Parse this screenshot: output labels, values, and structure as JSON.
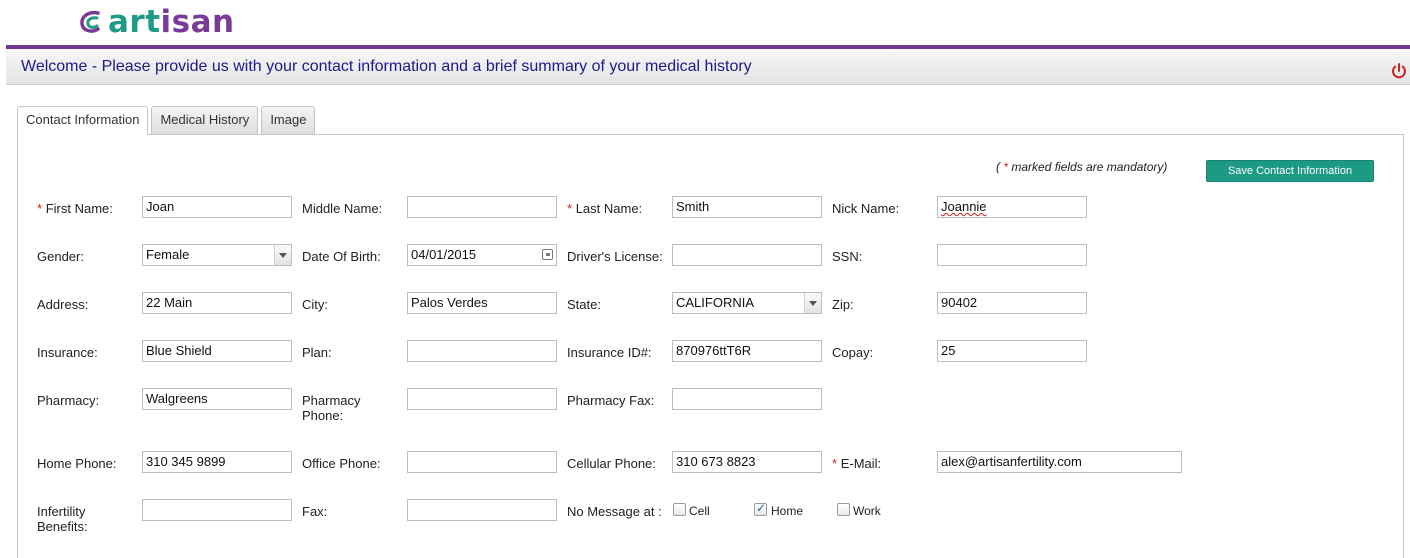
{
  "brand": {
    "name_part1": "art",
    "name_part2": "isan",
    "teal": "#1f9a84",
    "purple": "#7a3a97"
  },
  "header": {
    "welcome": "Welcome - Please provide us with your contact information and a brief summary of your medical history",
    "logout_icon": "power-icon"
  },
  "tabs": [
    {
      "label": "Contact Information",
      "active": true
    },
    {
      "label": "Medical History",
      "active": false
    },
    {
      "label": "Image",
      "active": false
    }
  ],
  "form": {
    "mandatory_note_prefix": "( ",
    "mandatory_note_star": "*",
    "mandatory_note_suffix": " marked fields are mandatory)",
    "save_label": "Save Contact Information",
    "first_name": {
      "label": "First Name:",
      "value": "Joan",
      "required": true
    },
    "middle_name": {
      "label": "Middle Name:",
      "value": ""
    },
    "last_name": {
      "label": "Last Name:",
      "value": "Smith",
      "required": true
    },
    "nick_name": {
      "label": "Nick Name:",
      "value": "Joannie"
    },
    "gender": {
      "label": "Gender:",
      "value": "Female"
    },
    "dob": {
      "label": "Date Of Birth:",
      "value": "04/01/2015"
    },
    "drivers_license": {
      "label": "Driver's License:",
      "value": ""
    },
    "ssn": {
      "label": "SSN:",
      "value": ""
    },
    "address": {
      "label": "Address:",
      "value": "22 Main"
    },
    "city": {
      "label": "City:",
      "value": "Palos Verdes"
    },
    "state": {
      "label": "State:",
      "value": "CALIFORNIA"
    },
    "zip": {
      "label": "Zip:",
      "value": "90402"
    },
    "insurance": {
      "label": "Insurance:",
      "value": "Blue Shield"
    },
    "plan": {
      "label": "Plan:",
      "value": ""
    },
    "insurance_id": {
      "label": "Insurance ID#:",
      "value": "870976ttT6R"
    },
    "copay": {
      "label": "Copay:",
      "value": "25"
    },
    "pharmacy": {
      "label": "Pharmacy:",
      "value": "Walgreens"
    },
    "pharmacy_phone": {
      "label_line1": "Pharmacy",
      "label_line2": "Phone:",
      "value": ""
    },
    "pharmacy_fax": {
      "label": "Pharmacy Fax:",
      "value": ""
    },
    "home_phone": {
      "label": "Home Phone:",
      "value": "310 345 9899"
    },
    "office_phone": {
      "label": "Office Phone:",
      "value": ""
    },
    "cellular_phone": {
      "label": "Cellular Phone:",
      "value": "310 673 8823"
    },
    "email": {
      "label": "E-Mail:",
      "value": "alex@artisanfertility.com",
      "required": true
    },
    "infertility_benefits": {
      "label_line1": "Infertility",
      "label_line2": "Benefits:",
      "value": ""
    },
    "fax": {
      "label": "Fax:",
      "value": ""
    },
    "no_message": {
      "label": "No Message at :",
      "options": [
        {
          "label": "Cell",
          "checked": false
        },
        {
          "label": "Home",
          "checked": true
        },
        {
          "label": "Work",
          "checked": false
        }
      ]
    }
  }
}
